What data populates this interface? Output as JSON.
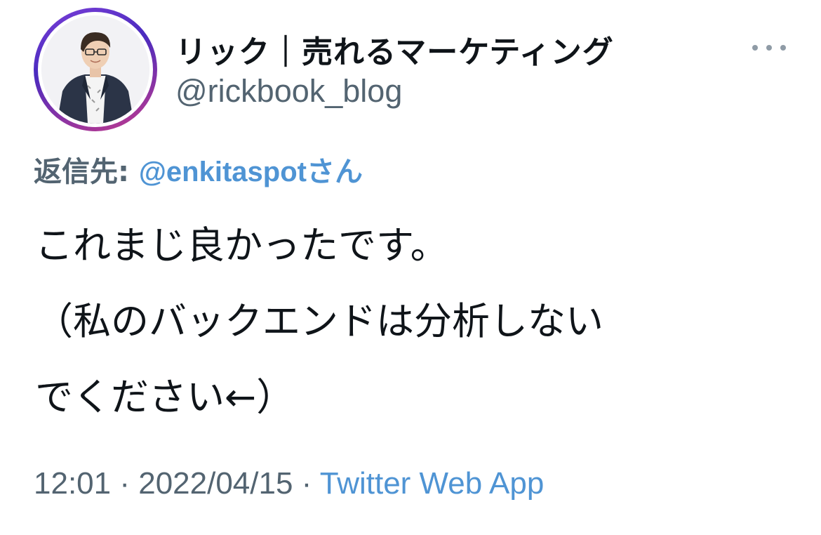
{
  "tweet": {
    "display_name": "リック｜売れるマーケティング",
    "handle": "@rickbook_blog",
    "reply_prefix": "返信先: ",
    "reply_mention": "@enkitaspotさん",
    "body_lines": [
      "これまじ良かったです。",
      "（私のバックエンドは分析しない",
      "でください←）"
    ],
    "time": "12:01",
    "separator": " · ",
    "date": "2022/04/15",
    "source": "Twitter Web App"
  },
  "icons": {
    "more": "more-horizontal-icon",
    "avatar": "profile-photo"
  },
  "colors": {
    "text": "#0f1419",
    "secondary": "#536471",
    "link": "#4f94d4",
    "avatar_ring": "#7b3fd8"
  }
}
